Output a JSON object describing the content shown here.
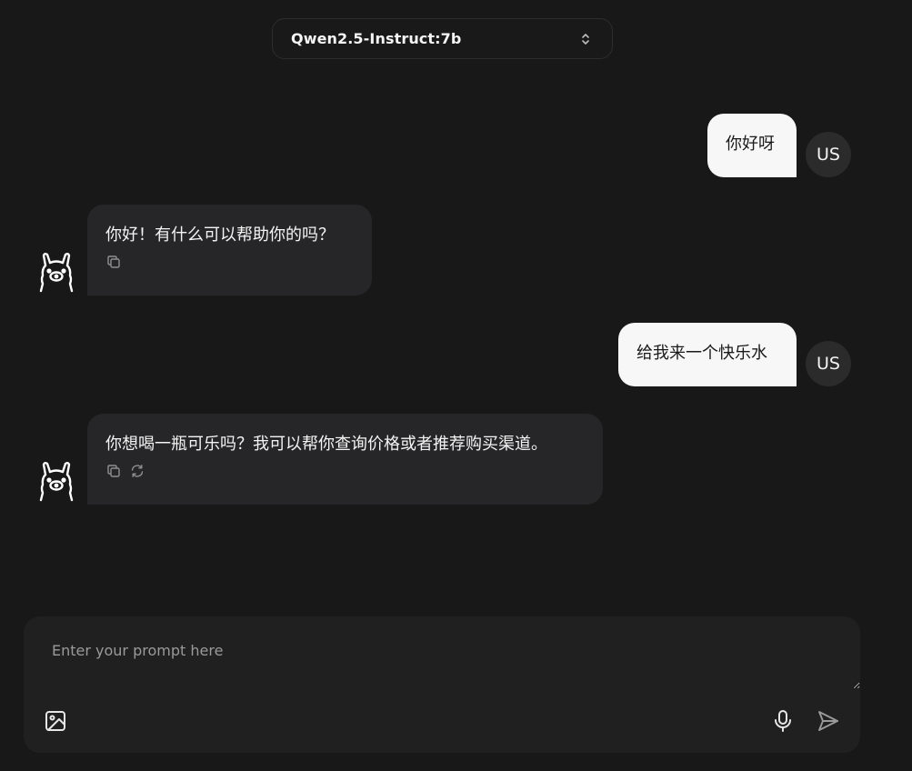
{
  "header": {
    "model": "Qwen2.5-Instruct:7b"
  },
  "conversation": [
    {
      "role": "user",
      "text": "你好呀",
      "avatar": "US"
    },
    {
      "role": "assistant",
      "text": "你好！有什么可以帮助你的吗？",
      "actions": [
        "copy-icon"
      ]
    },
    {
      "role": "user",
      "text": "给我来一个快乐水",
      "avatar": "US"
    },
    {
      "role": "assistant",
      "text": "你想喝一瓶可乐吗？我可以帮你查询价格或者推荐购买渠道。",
      "actions": [
        "copy-icon",
        "refresh-icon"
      ]
    }
  ],
  "composer": {
    "placeholder": "Enter your prompt here",
    "value": "",
    "left_tools": [
      "image-icon"
    ],
    "right_tools": [
      "microphone-icon",
      "send-icon"
    ]
  }
}
